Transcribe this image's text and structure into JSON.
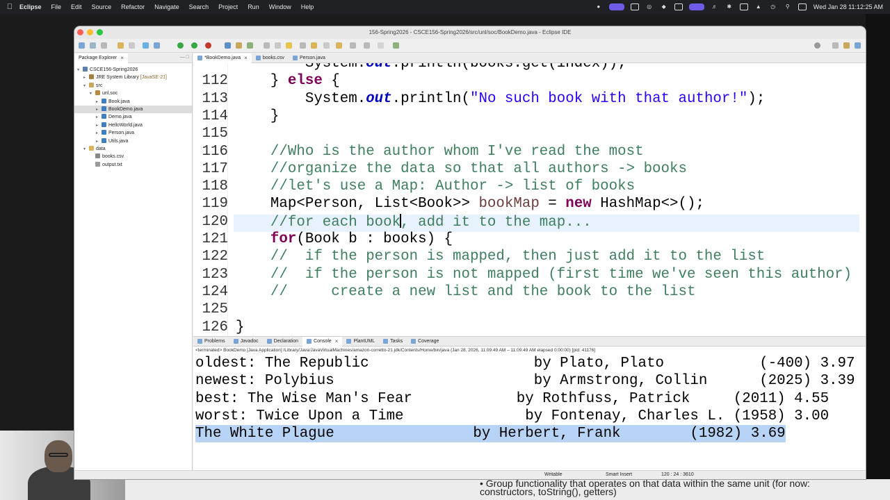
{
  "menubar": {
    "app": "Eclipse",
    "items": [
      "File",
      "Edit",
      "Source",
      "Refactor",
      "Navigate",
      "Search",
      "Project",
      "Run",
      "Window",
      "Help"
    ],
    "clock": "Wed Jan 28  11:12:25 AM"
  },
  "window": {
    "title": "156-Spring2026 - CSCE156-Spring2026/src/unl/soc/BookDemo.java - Eclipse IDE"
  },
  "explorer": {
    "tab_label": "Package Explorer",
    "tree": [
      {
        "label": "CSCE156-Spring2026",
        "depth": 0,
        "twist": "v",
        "icon": "project-icon"
      },
      {
        "label": "JRE System Library",
        "extra": " [JavaSE-21]",
        "depth": 1,
        "twist": ">",
        "icon": "library-icon"
      },
      {
        "label": "src",
        "depth": 1,
        "twist": "v",
        "icon": "source-folder-icon"
      },
      {
        "label": "unl.soc",
        "depth": 2,
        "twist": "v",
        "icon": "package-icon"
      },
      {
        "label": "Book.java",
        "depth": 3,
        "twist": ">",
        "icon": "java-file-icon"
      },
      {
        "label": "BookDemo.java",
        "depth": 3,
        "twist": ">",
        "icon": "java-file-icon",
        "selected": true
      },
      {
        "label": "Demo.java",
        "depth": 3,
        "twist": ">",
        "icon": "java-file-icon"
      },
      {
        "label": "HelloWorld.java",
        "depth": 3,
        "twist": ">",
        "icon": "java-file-icon"
      },
      {
        "label": "Person.java",
        "depth": 3,
        "twist": ">",
        "icon": "java-file-icon"
      },
      {
        "label": "Utils.java",
        "depth": 3,
        "twist": ">",
        "icon": "java-file-icon"
      },
      {
        "label": "data",
        "depth": 1,
        "twist": "v",
        "icon": "folder-icon"
      },
      {
        "label": "books.csv",
        "depth": 2,
        "twist": "",
        "icon": "csv-file-icon"
      },
      {
        "label": "output.txt",
        "depth": 2,
        "twist": "",
        "icon": "text-file-icon"
      }
    ]
  },
  "editor": {
    "tabs": [
      {
        "label": "*BookDemo.java",
        "active": true,
        "closable": true
      },
      {
        "label": "books.csv",
        "active": false
      },
      {
        "label": "Person.java",
        "active": false
      }
    ],
    "lines": [
      {
        "num": "",
        "segs": [
          {
            "t": "        System.",
            "c": ""
          },
          {
            "t": "out",
            "c": "fld"
          },
          {
            "t": ".println(books.get(index));",
            "c": ""
          }
        ]
      },
      {
        "num": "112",
        "segs": [
          {
            "t": "    } ",
            "c": ""
          },
          {
            "t": "else",
            "c": "kw"
          },
          {
            "t": " {",
            "c": ""
          }
        ]
      },
      {
        "num": "113",
        "segs": [
          {
            "t": "        System.",
            "c": ""
          },
          {
            "t": "out",
            "c": "fld"
          },
          {
            "t": ".println(",
            "c": ""
          },
          {
            "t": "\"No such book with that author!\"",
            "c": "st"
          },
          {
            "t": ");",
            "c": ""
          }
        ]
      },
      {
        "num": "114",
        "segs": [
          {
            "t": "    }",
            "c": ""
          }
        ]
      },
      {
        "num": "115",
        "segs": []
      },
      {
        "num": "116",
        "segs": [
          {
            "t": "    //Who is the author whom I've read the most",
            "c": "cm"
          }
        ]
      },
      {
        "num": "117",
        "segs": [
          {
            "t": "    //organize the data so that all authors -> books",
            "c": "cm"
          }
        ]
      },
      {
        "num": "118",
        "segs": [
          {
            "t": "    //let's use a Map: Author -> list of books",
            "c": "cm"
          }
        ]
      },
      {
        "num": "119",
        "segs": [
          {
            "t": "    Map<Person, List<Book>> ",
            "c": ""
          },
          {
            "t": "bookMap",
            "c": "fv"
          },
          {
            "t": " = ",
            "c": ""
          },
          {
            "t": "new",
            "c": "kw"
          },
          {
            "t": " HashMap<>();",
            "c": ""
          }
        ]
      },
      {
        "num": "120",
        "segs": [
          {
            "t": "    //for each book",
            "c": "cm"
          },
          {
            "t": "|",
            "c": "caret"
          },
          {
            "t": ", add it to the map...",
            "c": "cm"
          }
        ],
        "highlight": true
      },
      {
        "num": "121",
        "segs": [
          {
            "t": "    ",
            "c": ""
          },
          {
            "t": "for",
            "c": "kw"
          },
          {
            "t": "(Book b : books) {",
            "c": ""
          }
        ]
      },
      {
        "num": "122",
        "segs": [
          {
            "t": "    //  if the person is mapped, then just add it to the list",
            "c": "cm"
          }
        ]
      },
      {
        "num": "123",
        "segs": [
          {
            "t": "    //  if the person is not mapped (first time we've seen this author)",
            "c": "cm"
          }
        ]
      },
      {
        "num": "124",
        "segs": [
          {
            "t": "    //     create a new list and the book to the list",
            "c": "cm"
          }
        ]
      },
      {
        "num": "125",
        "segs": []
      },
      {
        "num": "126",
        "segs": [
          {
            "t": "}",
            "c": ""
          }
        ]
      }
    ]
  },
  "bottom": {
    "tabs": [
      {
        "label": "Problems",
        "active": false
      },
      {
        "label": "Javadoc",
        "active": false
      },
      {
        "label": "Declaration",
        "active": false
      },
      {
        "label": "Console",
        "active": true,
        "closable": true
      },
      {
        "label": "PlantUML",
        "active": false
      },
      {
        "label": "Tasks",
        "active": false
      },
      {
        "label": "Coverage",
        "active": false
      }
    ],
    "console_header": "<terminated> BookDemo [Java Application] /Library/Java/JavaVirtualMachines/amazon-corretto-21.jdk/Contents/Home/bin/java  (Jan 28, 2026, 11:09:49 AM – 11:09:49 AM elapsed 0:00:00) [pid: 41176]",
    "console_lines": [
      {
        "text": "oldest: The Republic                   by Plato, Plato           (-400) 3.97"
      },
      {
        "text": "newest: Polybius                       by Armstrong, Collin      (2025) 3.39"
      },
      {
        "text": "best: The Wise Man's Fear            by Rothfuss, Patrick     (2011) 4.55"
      },
      {
        "text": "worst: Twice Upon a Time              by Fontenay, Charles L. (1958) 3.00"
      },
      {
        "text": "The White Plague                by Herbert, Frank        (1982) 3.69",
        "selected": true
      }
    ]
  },
  "status": {
    "mode": "Writable",
    "insert": "Smart Insert",
    "position": "120 : 24 : 3610"
  },
  "slide": {
    "line1": "Group functionality that operates on that data within the same unit (for now:",
    "line2": "constructors, toString(), getters)"
  }
}
